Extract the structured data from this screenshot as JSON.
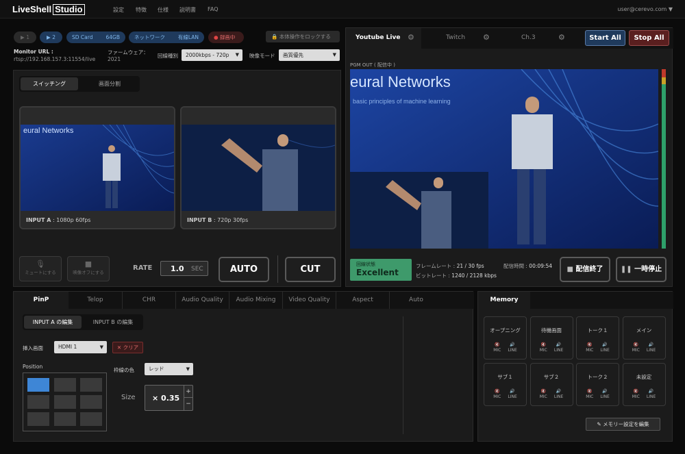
{
  "brand": {
    "name": "LiveShell",
    "suffix": "Studio"
  },
  "nav": [
    "設定",
    "特徴",
    "仕様",
    "説明書",
    "FAQ"
  ],
  "user": "user@cerevo.com ▼",
  "status": {
    "cam1": "1",
    "cam2": "2",
    "sd_label": "SD Card",
    "sd_size": "64GB",
    "net_label": "ネットワーク",
    "net_type": "有線LAN",
    "rec": "録画中",
    "lock": "本体操作をロックする"
  },
  "monitor": {
    "label": "Monitor URL :",
    "url": "rtsp://192.168.157.3:11554/live",
    "fw_label": "ファームウェア：",
    "fw": "2021",
    "line_label": "回線種別",
    "line_value": "2000kbps - 720p",
    "mode_label": "映像モード",
    "mode_value": "画質優先"
  },
  "switch_tabs": [
    "スイッチング",
    "画面分割"
  ],
  "inputs": [
    {
      "name": "INPUT A",
      "info": " : 1080p 60fps"
    },
    {
      "name": "INPUT B",
      "info": " : 720p 30fps"
    }
  ],
  "controls": {
    "mute": "ミュートにする",
    "video_off": "映像オフにする",
    "rate_label": "RATE",
    "rate_value": "1.0",
    "rate_unit": "SEC",
    "auto": "AUTO",
    "cut": "CUT"
  },
  "channels": [
    "Youtube Live",
    "Twitch",
    "Ch.3"
  ],
  "start_all": "Start All",
  "stop_all": "Stop All",
  "pgm_label": "PGM OUT ( 配信中 )",
  "stream": {
    "state_label": "回線状態",
    "state_value": "Excellent",
    "framerate_label": "フレームレート : ",
    "framerate": "21 / 30 fps",
    "bitrate_label": "ビットレート : ",
    "bitrate": "1240 / 2128 kbps",
    "time_label": "配信時間 : ",
    "time": "00:09:54",
    "end": "配信終了",
    "pause": "一時停止"
  },
  "screen_text": {
    "title": "eural Networks",
    "sub": "basic principles of machine learning"
  },
  "effect_tabs": [
    "PinP",
    "Telop",
    "CHR",
    "Audio Quality",
    "Audio Mixing",
    "Video Quality",
    "Aspect",
    "Auto"
  ],
  "pinp": {
    "edit_a": "INPUT A の編集",
    "edit_b": "INPUT B の編集",
    "insert_label": "挿入画面",
    "insert_value": "HDMI 1",
    "clear": "クリア",
    "position_label": "Position",
    "border_label": "枠線の色",
    "border_value": "レッド",
    "size_label": "Size",
    "size_value": "× 0.35"
  },
  "memory": {
    "tab": "Memory",
    "edit": "メモリー設定を編集",
    "mic": "MIC",
    "line": "LINE",
    "items": [
      "オープニング",
      "待機画面",
      "トーク１",
      "メイン",
      "サブ１",
      "サブ２",
      "トーク２",
      "未設定"
    ]
  },
  "colors": {
    "accent_blue": "#1f3a5c",
    "stop_red": "#5a1f1f",
    "excellent_green": "#3e9a6b",
    "meter_green": "#2ea06a"
  }
}
